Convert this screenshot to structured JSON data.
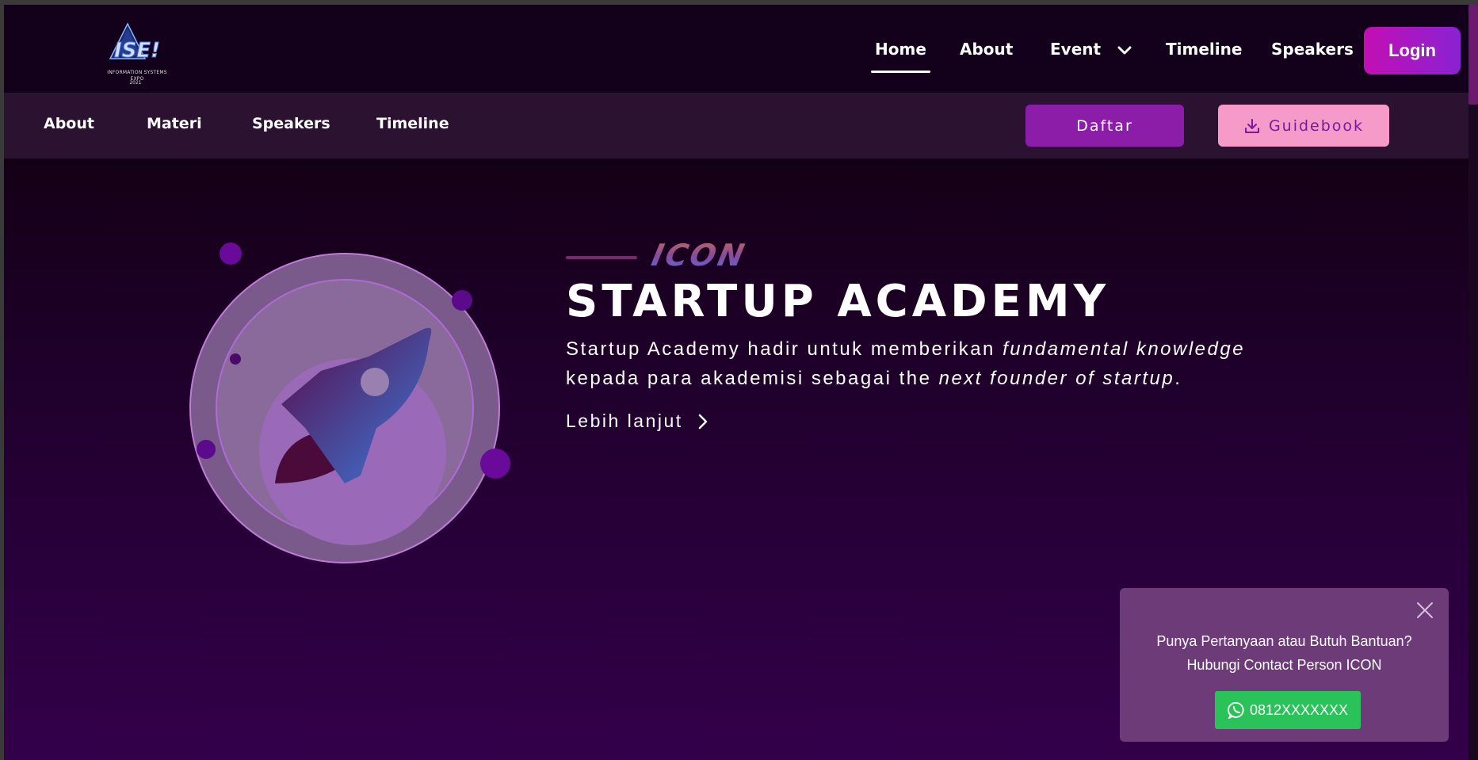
{
  "brand": {
    "logo_mark": "ISE!",
    "logo_subtitle": "INFORMATION SYSTEMS EXPO",
    "logo_year": "2021"
  },
  "topnav": {
    "items": [
      {
        "label": "Home",
        "active": true
      },
      {
        "label": "About"
      },
      {
        "label": "Event"
      },
      {
        "label": "Timeline"
      },
      {
        "label": "Speakers"
      }
    ],
    "login_label": "Login"
  },
  "subnav": {
    "items": [
      {
        "label": "About"
      },
      {
        "label": "Materi"
      },
      {
        "label": "Speakers"
      },
      {
        "label": "Timeline"
      }
    ],
    "daftar_label": "Daftar",
    "guidebook_label": "Guidebook"
  },
  "hero": {
    "brand_word": "ICON",
    "title": "STARTUP ACADEMY",
    "desc_part1": "Startup Academy hadir untuk memberikan ",
    "desc_em1": "fundamental knowledge",
    "desc_part2": "kepada para akademisi sebagai the ",
    "desc_em2": "next founder of startup",
    "desc_end": ".",
    "more_label": "Lebih lanjut"
  },
  "help": {
    "line1": "Punya Pertanyaan atau Butuh Bantuan?",
    "line2": "Hubungi Contact Person ICON",
    "phone": "0812XXXXXXX"
  },
  "colors": {
    "background": "#140016",
    "subbar": "#2a1230",
    "daftar": "#8c1da8",
    "guidebook": "#f59ac9",
    "login_gradient_start": "#c20fb3",
    "login_gradient_end": "#8a22d3",
    "whatsapp": "#2ac35a",
    "help_card": "#6c3b78"
  },
  "icons": [
    "chevron-down-icon",
    "download-icon",
    "chevron-right-icon",
    "close-icon",
    "whatsapp-icon",
    "rocket-icon"
  ]
}
